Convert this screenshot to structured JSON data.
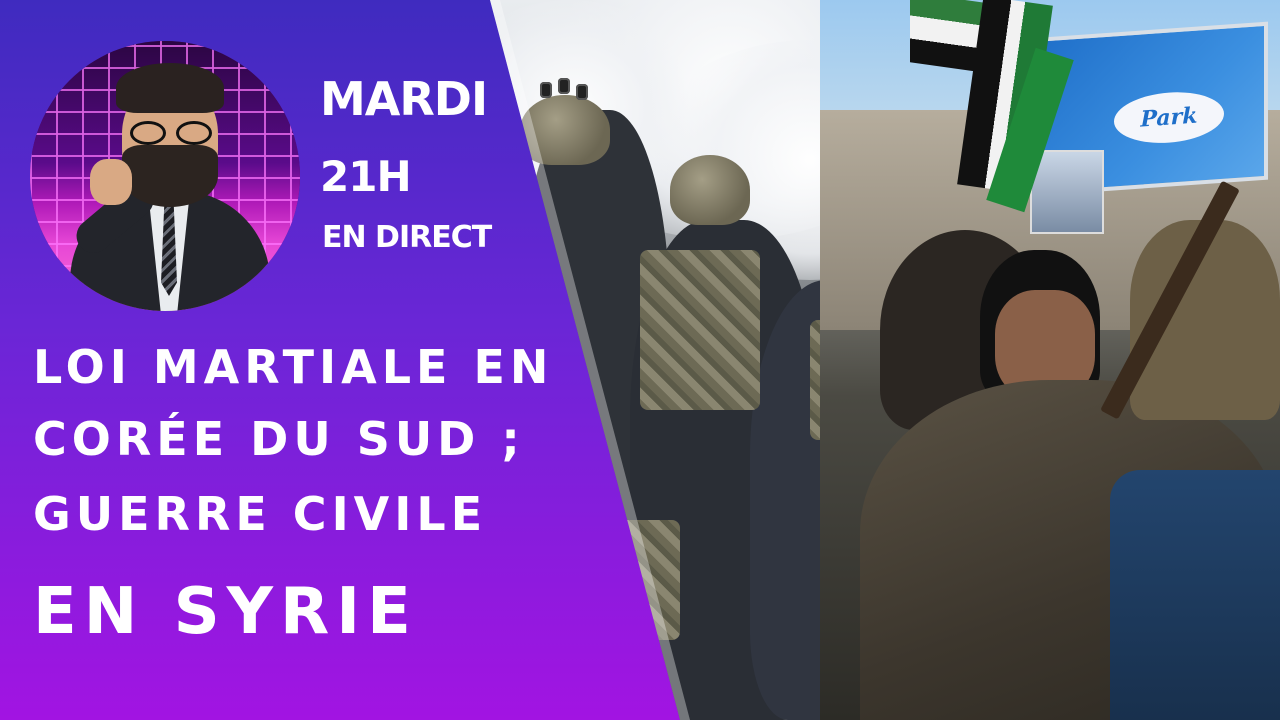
{
  "thumbnail": {
    "schedule": {
      "day": "MARDI",
      "time": "21H",
      "live": "EN DIRECT"
    },
    "headline": {
      "line1": "LOI MARTIALE EN",
      "line2": "CORÉE DU SUD ;",
      "line3": "GUERRE CIVILE",
      "line4": "EN SYRIE"
    },
    "billboard_text": "Park",
    "colors": {
      "panel_top": "#4a2bc7",
      "panel_bottom": "#9b12e0",
      "text": "#ffffff",
      "grid_glow": "#ff6fd8"
    }
  }
}
